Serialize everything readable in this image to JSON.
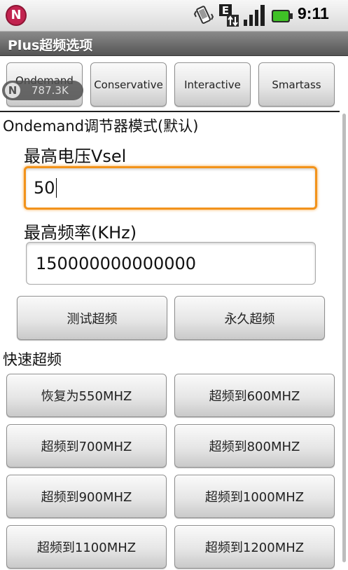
{
  "status_bar": {
    "time": "9:11",
    "network_type": "E",
    "logo_letter": "N",
    "icons": [
      "app-notification-icon",
      "vibrate-icon",
      "data-transfer-icon",
      "signal-icon",
      "battery-icon"
    ],
    "battery_color": "#3fc126"
  },
  "title_bar": {
    "title": "Plus超频选项"
  },
  "tabs": [
    {
      "label": "Ondemand"
    },
    {
      "label": "Conservative"
    },
    {
      "label": "Interactive"
    },
    {
      "label": "Smartass"
    }
  ],
  "speed_overlay": {
    "logo_letter": "N",
    "value": "787.3K"
  },
  "mode_title": "Ondemand调节器模式(默认)",
  "voltage": {
    "label": "最高电压Vsel",
    "value": "50"
  },
  "frequency": {
    "label": "最高频率(KHz)",
    "value": "150000000000000"
  },
  "actions": {
    "test_label": "测试超频",
    "permanent_label": "永久超频"
  },
  "quick": {
    "title": "快速超频",
    "buttons": [
      "恢复为550MHZ",
      "超频到600MHZ",
      "超频到700MHZ",
      "超频到800MHZ",
      "超频到900MHZ",
      "超频到1000MHZ",
      "超频到1100MHZ",
      "超频到1200MHZ"
    ]
  },
  "colors": {
    "focus": "#f2931b",
    "title_bar": "#6b6b6b",
    "logo": "#c2234f"
  }
}
